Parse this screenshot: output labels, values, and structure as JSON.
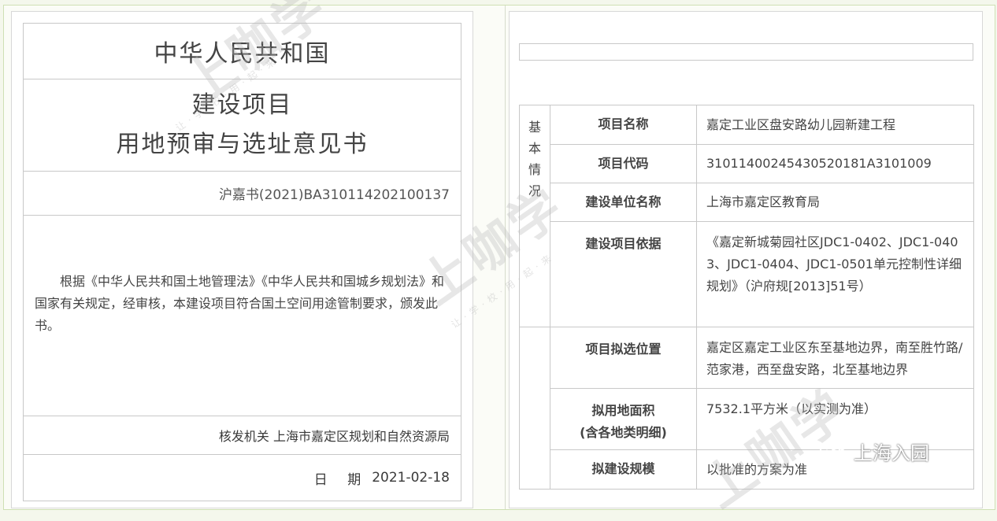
{
  "left": {
    "country": "中华人民共和国",
    "title_line1": "建设项目",
    "title_line2": "用地预审与选址意见书",
    "doc_number": "沪嘉书(2021)BA310114202100137",
    "body": "根据《中华人民共和国土地管理法》《中华人民共和国城乡规划法》和国家有关规定，经审核，本建设项目符合国土空间用途管制要求，颁发此书。",
    "issuer_label": "核发机关",
    "issuer": "上海市嘉定区规划和自然资源局",
    "date_label": "日 期",
    "date": "2021-02-18"
  },
  "right": {
    "section_label": [
      "基",
      "本",
      "情",
      "况"
    ],
    "rows": [
      {
        "field": "项目名称",
        "value": "嘉定工业区盘安路幼儿园新建工程"
      },
      {
        "field": "项目代码",
        "value": "310114002454305201​81A3101009"
      },
      {
        "field": "建设单位名称",
        "value": "上海市嘉定区教育局"
      },
      {
        "field": "建设项目依据",
        "value": "《嘉定新城菊园社区JDC1-0402、JDC1-0403、JDC1-0404、JDC1-0501单元控制性详细规划》（沪府规[2013]51号）"
      },
      {
        "field": "项目拟选位置",
        "value": "嘉定区嘉定工业区东至基地边界，南至胜竹路/范家港，西至盘安路，北至基地边界"
      },
      {
        "field": "拟用地面积",
        "field2": "(含各地类明细)",
        "value": "7532.1平方米（以实测为准）"
      },
      {
        "field": "拟建设规模",
        "value": "以批准的方案为准"
      }
    ]
  },
  "overlay": {
    "watermark_text": "上咖学",
    "watermark_small": "让·学·校·用·起·来",
    "wechat_name": "上海入园",
    "wechat_icon": "wechat-icon"
  }
}
